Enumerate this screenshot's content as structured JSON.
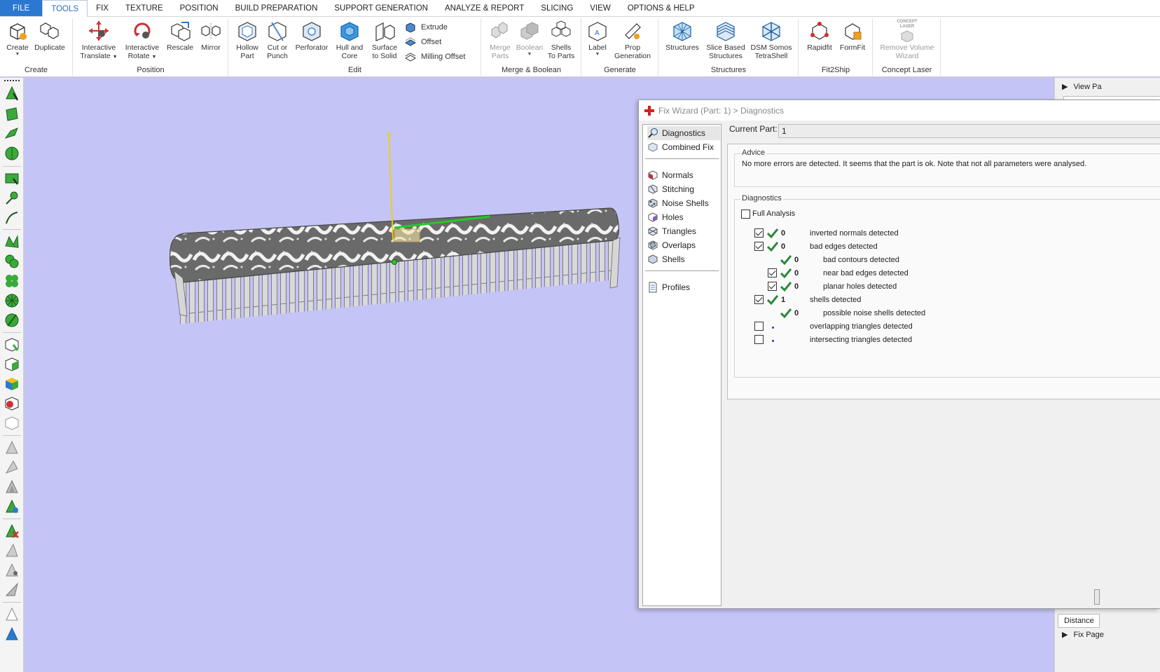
{
  "menu": {
    "items": [
      "FILE",
      "TOOLS",
      "FIX",
      "TEXTURE",
      "POSITION",
      "BUILD PREPARATION",
      "SUPPORT GENERATION",
      "ANALYZE & REPORT",
      "SLICING",
      "VIEW",
      "OPTIONS & HELP"
    ],
    "active": "TOOLS"
  },
  "ribbon": {
    "create": {
      "label": "Create",
      "create": "Create",
      "duplicate": "Duplicate"
    },
    "position": {
      "label": "Position",
      "translate_1": "Interactive",
      "translate_2": "Translate",
      "rotate_1": "Interactive",
      "rotate_2": "Rotate",
      "rescale": "Rescale",
      "mirror": "Mirror"
    },
    "edit": {
      "label": "Edit",
      "hollow_1": "Hollow",
      "hollow_2": "Part",
      "cut_1": "Cut or",
      "cut_2": "Punch",
      "perforator": "Perforator",
      "hull_1": "Hull and",
      "hull_2": "Core",
      "surface_1": "Surface",
      "surface_2": "to Solid",
      "extrude": "Extrude",
      "offset": "Offset",
      "milling": "Milling Offset"
    },
    "merge": {
      "label": "Merge & Boolean",
      "merge_1": "Merge",
      "merge_2": "Parts",
      "boolean": "Boolean",
      "shells_1": "Shells",
      "shells_2": "To Parts"
    },
    "generate": {
      "label": "Generate",
      "label_btn": "Label",
      "prop_1": "Prop",
      "prop_2": "Generation"
    },
    "structures": {
      "label": "Structures",
      "structures": "Structures",
      "slice_1": "Slice Based",
      "slice_2": "Structures",
      "dsm_1": "DSM Somos",
      "dsm_2": "TetraShell"
    },
    "fit2ship": {
      "label": "Fit2Ship",
      "rapidfit": "Rapidfit",
      "formfit": "FormFit"
    },
    "concept": {
      "label": "Concept Laser",
      "logo_1": "CONCEPT",
      "logo_2": "LASER",
      "remove_1": "Remove Volume",
      "remove_2": "Wizard"
    }
  },
  "viewport": {
    "axis_label": "Y",
    "colors": {
      "background": "#c4c4f6",
      "axis": "#e8d400",
      "selection": "#22cc22"
    }
  },
  "right_dock": {
    "view_pane": "View Pa",
    "distance_tab": "Distance",
    "fix_pane": "Fix Page"
  },
  "fix_wizard": {
    "title": "Fix Wizard (Part: 1) > Diagnostics",
    "nav": {
      "diagnostics": "Diagnostics",
      "combined_fix": "Combined Fix",
      "normals": "Normals",
      "stitching": "Stitching",
      "noise_shells": "Noise Shells",
      "holes": "Holes",
      "triangles": "Triangles",
      "overlaps": "Overlaps",
      "shells": "Shells",
      "profiles": "Profiles"
    },
    "current_part_label": "Current Part:",
    "current_part_value": "1",
    "advice_label": "Advice",
    "advice_text": "No more errors are detected. It seems that the part is ok. Note that not all parameters were analysed.",
    "diagnostics_label": "Diagnostics",
    "full_analysis": "Full Analysis",
    "rows": [
      {
        "checked": true,
        "status": "ok",
        "count": "0",
        "label": "inverted normals detected"
      },
      {
        "checked": true,
        "status": "ok",
        "count": "0",
        "label": "bad edges detected"
      },
      {
        "checked": null,
        "status": "ok",
        "count": "0",
        "label": "bad contours detected"
      },
      {
        "checked": true,
        "status": "ok",
        "count": "0",
        "label": "near bad edges detected"
      },
      {
        "checked": true,
        "status": "ok",
        "count": "0",
        "label": "planar holes detected"
      },
      {
        "checked": true,
        "status": "ok",
        "count": "1",
        "label": "shells detected"
      },
      {
        "checked": null,
        "status": "ok",
        "count": "0",
        "label": "possible noise shells detected"
      },
      {
        "checked": false,
        "status": "pending",
        "count": "",
        "label": "overlapping triangles detected"
      },
      {
        "checked": false,
        "status": "pending",
        "count": "",
        "label": "intersecting triangles detected"
      }
    ]
  }
}
